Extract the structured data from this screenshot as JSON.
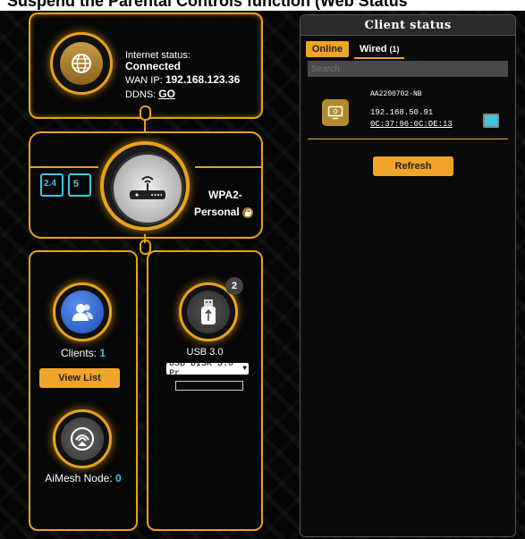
{
  "header_fragment": "Suspend the Parental Controls function (Web Status",
  "internet": {
    "status_label": "Internet status:",
    "status_value": "Connected",
    "wan_ip_label": "WAN IP:",
    "wan_ip_value": "192.168.123.36",
    "ddns_label": "DDNS:",
    "ddns_link": "GO"
  },
  "wireless": {
    "band_24": "2.4",
    "band_5": "5",
    "security_line1": "WPA2-",
    "security_line2": "Personal"
  },
  "clients": {
    "label": "Clients:",
    "count": "1",
    "view_list_button": "View List"
  },
  "aimesh": {
    "label": "AiMesh Node:",
    "count": "0"
  },
  "usb": {
    "badge": "2",
    "label": "USB 3.0",
    "selected_disk": "USB DISK 3.0 Pr"
  },
  "client_status": {
    "title": "Client status",
    "tab_online": "Online",
    "tab_wired": "Wired",
    "tab_wired_count": "(1)",
    "search_placeholder": "Search",
    "device": {
      "name": "AA2200702-NB",
      "ip": "192.168.50.91",
      "mac": "0C:37:96:0C:DE:13"
    },
    "refresh_button": "Refresh"
  },
  "colors": {
    "accent": "#e8a317",
    "button": "#f0a42a",
    "count": "#37c8e6",
    "client_icon": "#b38a2e"
  }
}
